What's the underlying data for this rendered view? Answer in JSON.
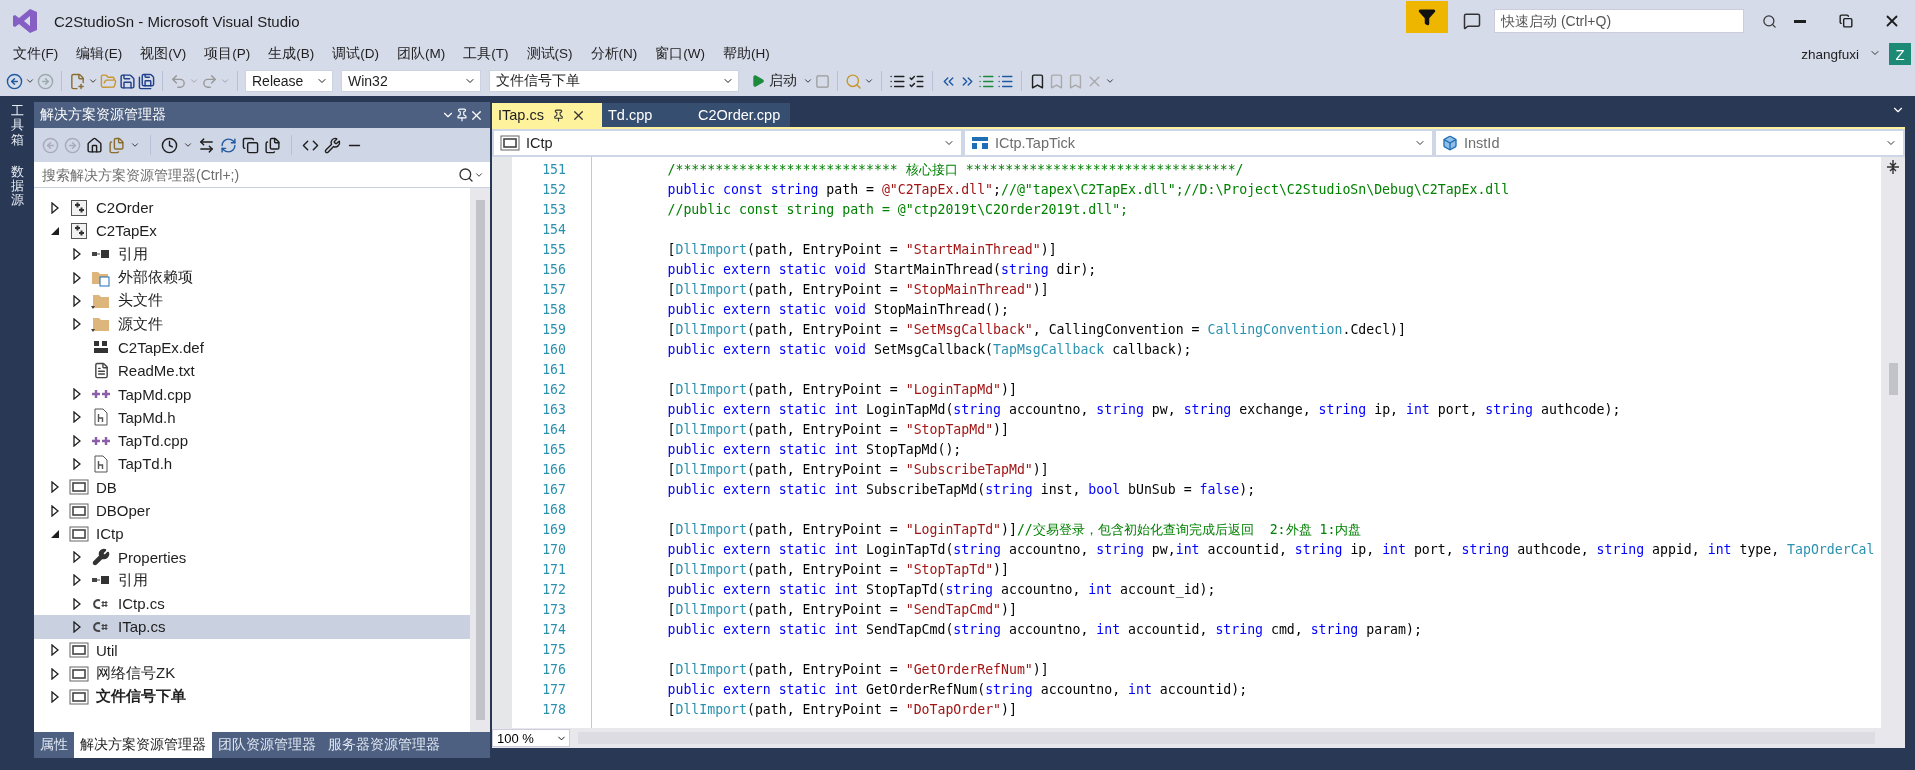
{
  "window": {
    "title": "C2StudioSn - Microsoft Visual Studio",
    "quick_launch": {
      "placeholder": "快速启动 (Ctrl+Q)"
    },
    "user": {
      "name": "zhangfuxi",
      "initial": "Z"
    }
  },
  "menu": [
    "文件(F)",
    "编辑(E)",
    "视图(V)",
    "项目(P)",
    "生成(B)",
    "调试(D)",
    "团队(M)",
    "工具(T)",
    "测试(S)",
    "分析(N)",
    "窗口(W)",
    "帮助(H)"
  ],
  "toolbar": {
    "configuration": "Release",
    "platform": "Win32",
    "startup_project": "文件信号下单",
    "start_button": "启动"
  },
  "side_tabs": [
    "工具箱",
    "数据源"
  ],
  "solution_explorer": {
    "title": "解决方案资源管理器",
    "search": {
      "placeholder": "搜索解决方案资源管理器(Ctrl+;)"
    },
    "items": [
      {
        "label": "C2Order",
        "kind": "cpp-project",
        "expanded": false,
        "selected": false
      },
      {
        "label": "C2TapEx",
        "kind": "cpp-project",
        "expanded": true,
        "selected": false,
        "children": [
          {
            "label": "引用",
            "kind": "references",
            "expanded": false,
            "selected": false
          },
          {
            "label": "外部依赖项",
            "kind": "dependencies",
            "expanded": false,
            "selected": false
          },
          {
            "label": "头文件",
            "kind": "folder",
            "expanded": false,
            "selected": false
          },
          {
            "label": "源文件",
            "kind": "folder",
            "expanded": false,
            "selected": false
          },
          {
            "label": "C2TapEx.def",
            "kind": "def",
            "selected": false
          },
          {
            "label": "ReadMe.txt",
            "kind": "text",
            "selected": false
          },
          {
            "label": "TapMd.cpp",
            "kind": "cpp",
            "expanded": false,
            "selected": false
          },
          {
            "label": "TapMd.h",
            "kind": "header",
            "expanded": false,
            "selected": false
          },
          {
            "label": "TapTd.cpp",
            "kind": "cpp",
            "expanded": false,
            "selected": false
          },
          {
            "label": "TapTd.h",
            "kind": "header",
            "expanded": false,
            "selected": false
          }
        ]
      },
      {
        "label": "DB",
        "kind": "cs-project",
        "expanded": false,
        "selected": false
      },
      {
        "label": "DBOper",
        "kind": "cs-project",
        "expanded": false,
        "selected": false
      },
      {
        "label": "ICtp",
        "kind": "cs-project",
        "expanded": true,
        "selected": false,
        "children": [
          {
            "label": "Properties",
            "kind": "properties",
            "expanded": false,
            "selected": false
          },
          {
            "label": "引用",
            "kind": "references",
            "expanded": false,
            "selected": false
          },
          {
            "label": "ICtp.cs",
            "kind": "cs",
            "expanded": false,
            "selected": false
          },
          {
            "label": "ITap.cs",
            "kind": "cs",
            "expanded": false,
            "selected": true
          }
        ]
      },
      {
        "label": "Util",
        "kind": "cs-project",
        "expanded": false,
        "selected": false
      },
      {
        "label": "网络信号ZK",
        "kind": "cs-project",
        "expanded": false,
        "selected": false
      },
      {
        "label": "文件信号下单",
        "kind": "cs-project",
        "expanded": false,
        "selected": false,
        "startup": true
      }
    ],
    "bottom_tabs": [
      {
        "label": "属性",
        "selected": false
      },
      {
        "label": "解决方案资源管理器",
        "selected": true
      },
      {
        "label": "团队资源管理器",
        "selected": false
      },
      {
        "label": "服务器资源管理器",
        "selected": false
      }
    ]
  },
  "editor": {
    "tabs": [
      {
        "label": "ITap.cs",
        "selected": true
      },
      {
        "label": "Td.cpp",
        "selected": false
      },
      {
        "label": "C2Order.cpp",
        "selected": false
      }
    ],
    "nav": [
      {
        "label": "ICtp",
        "kind": "project"
      },
      {
        "label": "ICtp.TapTick",
        "kind": "class"
      },
      {
        "label": "InstId",
        "kind": "field"
      }
    ],
    "lines": [
      {
        "number": "151",
        "tokens": [
          {
            "kind": "comment",
            "text": "/**************************** 核心接口 **********************************/"
          }
        ]
      },
      {
        "number": "152",
        "tokens": [
          {
            "kind": "keyword",
            "text": "public const string"
          },
          {
            "kind": "plain",
            "text": " path = "
          },
          {
            "kind": "string",
            "text": "@\"C2TapEx.dll\""
          },
          {
            "kind": "plain",
            "text": ";"
          },
          {
            "kind": "comment",
            "text": "//@\"tapex\\C2TapEx.dll\";//D:\\Project\\C2StudioSn\\Debug\\C2TapEx.dll"
          }
        ]
      },
      {
        "number": "153",
        "tokens": [
          {
            "kind": "comment",
            "text": "//public const string path = @\"ctp2019t\\C2Order2019t.dll\";"
          }
        ]
      },
      {
        "number": "154"
      },
      {
        "number": "155",
        "tokens": [
          {
            "kind": "plain",
            "text": "["
          },
          {
            "kind": "type",
            "text": "DllImport"
          },
          {
            "kind": "plain",
            "text": "(path, EntryPoint = "
          },
          {
            "kind": "string",
            "text": "\"StartMainThread\""
          },
          {
            "kind": "plain",
            "text": ")]"
          }
        ]
      },
      {
        "number": "156",
        "tokens": [
          {
            "kind": "keyword",
            "text": "public extern static void"
          },
          {
            "kind": "plain",
            "text": " StartMainThread("
          },
          {
            "kind": "keyword",
            "text": "string"
          },
          {
            "kind": "plain",
            "text": " dir);"
          }
        ]
      },
      {
        "number": "157",
        "tokens": [
          {
            "kind": "plain",
            "text": "["
          },
          {
            "kind": "type",
            "text": "DllImport"
          },
          {
            "kind": "plain",
            "text": "(path, EntryPoint = "
          },
          {
            "kind": "string",
            "text": "\"StopMainThread\""
          },
          {
            "kind": "plain",
            "text": ")]"
          }
        ]
      },
      {
        "number": "158",
        "tokens": [
          {
            "kind": "keyword",
            "text": "public extern static void"
          },
          {
            "kind": "plain",
            "text": " StopMainThread();"
          }
        ]
      },
      {
        "number": "159",
        "tokens": [
          {
            "kind": "plain",
            "text": "["
          },
          {
            "kind": "type",
            "text": "DllImport"
          },
          {
            "kind": "plain",
            "text": "(path, EntryPoint = "
          },
          {
            "kind": "string",
            "text": "\"SetMsgCallback\""
          },
          {
            "kind": "plain",
            "text": ", CallingConvention = "
          },
          {
            "kind": "type",
            "text": "CallingConvention"
          },
          {
            "kind": "plain",
            "text": ".Cdecl)]"
          }
        ]
      },
      {
        "number": "160",
        "tokens": [
          {
            "kind": "keyword",
            "text": "public extern static void"
          },
          {
            "kind": "plain",
            "text": " SetMsgCallback("
          },
          {
            "kind": "type",
            "text": "TapMsgCallback"
          },
          {
            "kind": "plain",
            "text": " callback);"
          }
        ]
      },
      {
        "number": "161"
      },
      {
        "number": "162",
        "tokens": [
          {
            "kind": "plain",
            "text": "["
          },
          {
            "kind": "type",
            "text": "DllImport"
          },
          {
            "kind": "plain",
            "text": "(path, EntryPoint = "
          },
          {
            "kind": "string",
            "text": "\"LoginTapMd\""
          },
          {
            "kind": "plain",
            "text": ")]"
          }
        ]
      },
      {
        "number": "163",
        "tokens": [
          {
            "kind": "keyword",
            "text": "public extern static int"
          },
          {
            "kind": "plain",
            "text": " LoginTapMd("
          },
          {
            "kind": "keyword",
            "text": "string"
          },
          {
            "kind": "plain",
            "text": " accountno, "
          },
          {
            "kind": "keyword",
            "text": "string"
          },
          {
            "kind": "plain",
            "text": " pw, "
          },
          {
            "kind": "keyword",
            "text": "string"
          },
          {
            "kind": "plain",
            "text": " exchange, "
          },
          {
            "kind": "keyword",
            "text": "string"
          },
          {
            "kind": "plain",
            "text": " ip, "
          },
          {
            "kind": "keyword",
            "text": "int"
          },
          {
            "kind": "plain",
            "text": " port, "
          },
          {
            "kind": "keyword",
            "text": "string"
          },
          {
            "kind": "plain",
            "text": " authcode);"
          }
        ]
      },
      {
        "number": "164",
        "tokens": [
          {
            "kind": "plain",
            "text": "["
          },
          {
            "kind": "type",
            "text": "DllImport"
          },
          {
            "kind": "plain",
            "text": "(path, EntryPoint = "
          },
          {
            "kind": "string",
            "text": "\"StopTapMd\""
          },
          {
            "kind": "plain",
            "text": ")]"
          }
        ]
      },
      {
        "number": "165",
        "tokens": [
          {
            "kind": "keyword",
            "text": "public extern static int"
          },
          {
            "kind": "plain",
            "text": " StopTapMd();"
          }
        ]
      },
      {
        "number": "166",
        "tokens": [
          {
            "kind": "plain",
            "text": "["
          },
          {
            "kind": "type",
            "text": "DllImport"
          },
          {
            "kind": "plain",
            "text": "(path, EntryPoint = "
          },
          {
            "kind": "string",
            "text": "\"SubscribeTapMd\""
          },
          {
            "kind": "plain",
            "text": ")]"
          }
        ]
      },
      {
        "number": "167",
        "tokens": [
          {
            "kind": "keyword",
            "text": "public extern static int"
          },
          {
            "kind": "plain",
            "text": " SubscribeTapMd("
          },
          {
            "kind": "keyword",
            "text": "string"
          },
          {
            "kind": "plain",
            "text": " inst, "
          },
          {
            "kind": "keyword",
            "text": "bool"
          },
          {
            "kind": "plain",
            "text": " bUnSub = "
          },
          {
            "kind": "keyword",
            "text": "false"
          },
          {
            "kind": "plain",
            "text": ");"
          }
        ]
      },
      {
        "number": "168"
      },
      {
        "number": "169",
        "tokens": [
          {
            "kind": "plain",
            "text": "["
          },
          {
            "kind": "type",
            "text": "DllImport"
          },
          {
            "kind": "plain",
            "text": "(path, EntryPoint = "
          },
          {
            "kind": "string",
            "text": "\"LoginTapTd\""
          },
          {
            "kind": "plain",
            "text": ")]"
          },
          {
            "kind": "comment",
            "text": "//交易登录，包含初始化查询完成后返回  2:外盘 1:内盘"
          }
        ]
      },
      {
        "number": "170",
        "tokens": [
          {
            "kind": "keyword",
            "text": "public extern static int"
          },
          {
            "kind": "plain",
            "text": " LoginTapTd("
          },
          {
            "kind": "keyword",
            "text": "string"
          },
          {
            "kind": "plain",
            "text": " accountno, "
          },
          {
            "kind": "keyword",
            "text": "string"
          },
          {
            "kind": "plain",
            "text": " pw,"
          },
          {
            "kind": "keyword",
            "text": "int"
          },
          {
            "kind": "plain",
            "text": " accountid, "
          },
          {
            "kind": "keyword",
            "text": "string"
          },
          {
            "kind": "plain",
            "text": " ip, "
          },
          {
            "kind": "keyword",
            "text": "int"
          },
          {
            "kind": "plain",
            "text": " port, "
          },
          {
            "kind": "keyword",
            "text": "string"
          },
          {
            "kind": "plain",
            "text": " authcode, "
          },
          {
            "kind": "keyword",
            "text": "string"
          },
          {
            "kind": "plain",
            "text": " appid, "
          },
          {
            "kind": "keyword",
            "text": "int"
          },
          {
            "kind": "plain",
            "text": " type, "
          },
          {
            "kind": "type",
            "text": "TapOrderCal"
          }
        ]
      },
      {
        "number": "171",
        "tokens": [
          {
            "kind": "plain",
            "text": "["
          },
          {
            "kind": "type",
            "text": "DllImport"
          },
          {
            "kind": "plain",
            "text": "(path, EntryPoint = "
          },
          {
            "kind": "string",
            "text": "\"StopTapTd\""
          },
          {
            "kind": "plain",
            "text": ")]"
          }
        ]
      },
      {
        "number": "172",
        "tokens": [
          {
            "kind": "keyword",
            "text": "public extern static int"
          },
          {
            "kind": "plain",
            "text": " StopTapTd("
          },
          {
            "kind": "keyword",
            "text": "string"
          },
          {
            "kind": "plain",
            "text": " accountno, "
          },
          {
            "kind": "keyword",
            "text": "int"
          },
          {
            "kind": "plain",
            "text": " account_id);"
          }
        ]
      },
      {
        "number": "173",
        "tokens": [
          {
            "kind": "plain",
            "text": "["
          },
          {
            "kind": "type",
            "text": "DllImport"
          },
          {
            "kind": "plain",
            "text": "(path, EntryPoint = "
          },
          {
            "kind": "string",
            "text": "\"SendTapCmd\""
          },
          {
            "kind": "plain",
            "text": ")]"
          }
        ]
      },
      {
        "number": "174",
        "tokens": [
          {
            "kind": "keyword",
            "text": "public extern static int"
          },
          {
            "kind": "plain",
            "text": " SendTapCmd("
          },
          {
            "kind": "keyword",
            "text": "string"
          },
          {
            "kind": "plain",
            "text": " accountno, "
          },
          {
            "kind": "keyword",
            "text": "int"
          },
          {
            "kind": "plain",
            "text": " accountid, "
          },
          {
            "kind": "keyword",
            "text": "string"
          },
          {
            "kind": "plain",
            "text": " cmd, "
          },
          {
            "kind": "keyword",
            "text": "string"
          },
          {
            "kind": "plain",
            "text": " param);"
          }
        ]
      },
      {
        "number": "175"
      },
      {
        "number": "176",
        "tokens": [
          {
            "kind": "plain",
            "text": "["
          },
          {
            "kind": "type",
            "text": "DllImport"
          },
          {
            "kind": "plain",
            "text": "(path, EntryPoint = "
          },
          {
            "kind": "string",
            "text": "\"GetOrderRefNum\""
          },
          {
            "kind": "plain",
            "text": ")]"
          }
        ]
      },
      {
        "number": "177",
        "tokens": [
          {
            "kind": "keyword",
            "text": "public extern static int"
          },
          {
            "kind": "plain",
            "text": " GetOrderRefNum("
          },
          {
            "kind": "keyword",
            "text": "string"
          },
          {
            "kind": "plain",
            "text": " accountno, "
          },
          {
            "kind": "keyword",
            "text": "int"
          },
          {
            "kind": "plain",
            "text": " accountid);"
          }
        ]
      },
      {
        "number": "178",
        "tokens": [
          {
            "kind": "plain",
            "text": "["
          },
          {
            "kind": "type",
            "text": "DllImport"
          },
          {
            "kind": "plain",
            "text": "(path, EntryPoint = "
          },
          {
            "kind": "string",
            "text": "\"DoTapOrder\""
          },
          {
            "kind": "plain",
            "text": ")]"
          }
        ]
      }
    ],
    "zoom": "100 %"
  }
}
